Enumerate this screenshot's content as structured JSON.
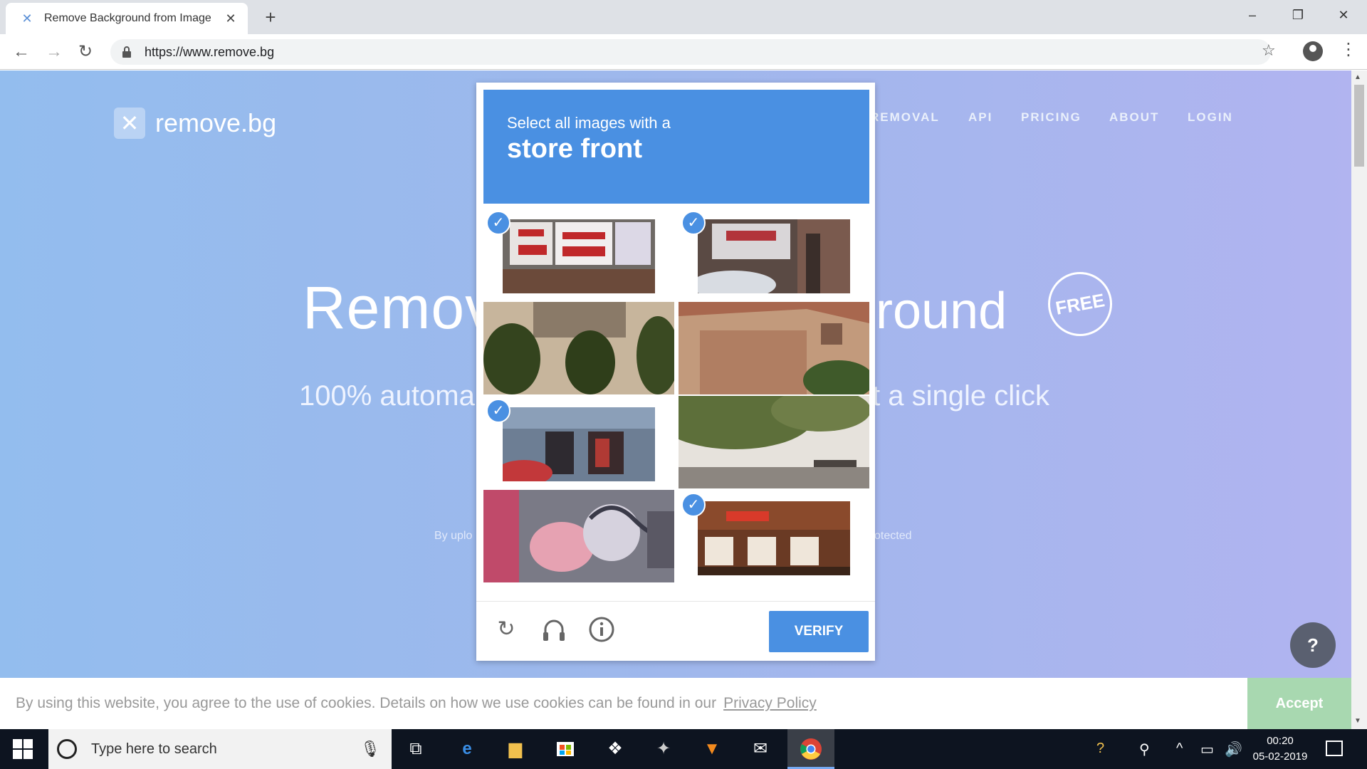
{
  "browser": {
    "tab_title": "Remove Background from Image",
    "new_tab": "+",
    "url": "https://www.remove.bg",
    "win_minimize": "–",
    "win_restore": "❐",
    "win_close": "✕"
  },
  "site": {
    "logo_text": "remove.bg",
    "nav": [
      "REMOVAL",
      "API",
      "PRICING",
      "ABOUT",
      "LOGIN"
    ],
    "hero_start": "Remov",
    "hero_end": "round",
    "free_badge": "FREE",
    "subtitle_start": "100% automa",
    "subtitle_end": "t a single click",
    "fine_left": "By uplo",
    "fine_right": "otected",
    "help": "?"
  },
  "captcha": {
    "prompt": "Select all images with a",
    "target": "store front",
    "tiles": [
      {
        "label": "storefront-signs",
        "selected": true
      },
      {
        "label": "storefront-shop",
        "selected": true
      },
      {
        "label": "building-wall-shrubs",
        "selected": false
      },
      {
        "label": "house-garage",
        "selected": false
      },
      {
        "label": "shop-row",
        "selected": true
      },
      {
        "label": "tree-wall",
        "selected": false
      },
      {
        "label": "graffiti-wall",
        "selected": false
      },
      {
        "label": "restaurant-front",
        "selected": true
      }
    ],
    "verify_label": "VERIFY"
  },
  "cookie": {
    "text": "By using this website, you agree to the use of cookies. Details on how we use cookies can be found in our",
    "link": "Privacy Policy",
    "accept": "Accept"
  },
  "taskbar": {
    "search_placeholder": "Type here to search",
    "time": "00:20",
    "date": "05-02-2019"
  },
  "colors": {
    "accent": "#4a90e2",
    "accept_green": "#a8d8b0"
  }
}
